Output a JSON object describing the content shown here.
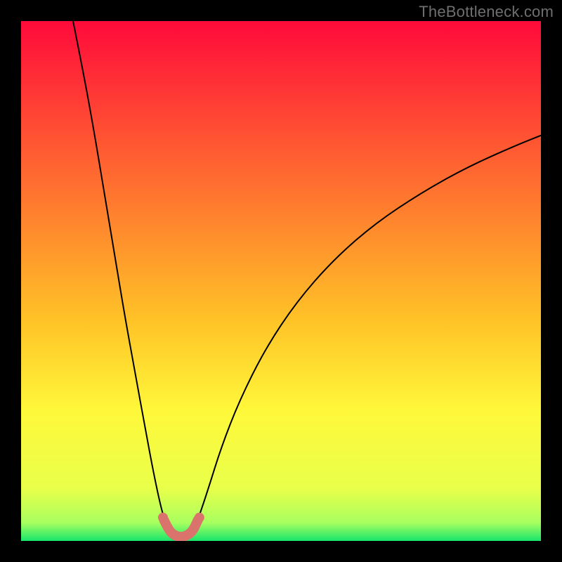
{
  "watermark": "TheBottleneck.com",
  "chart_data": {
    "type": "line",
    "title": "",
    "xlabel": "",
    "ylabel": "",
    "xlim": [
      0,
      100
    ],
    "ylim": [
      0,
      100
    ],
    "grid": false,
    "legend": false,
    "gradient_stops": [
      {
        "offset": 0.0,
        "color": "#ff0a3a"
      },
      {
        "offset": 0.18,
        "color": "#ff4534"
      },
      {
        "offset": 0.4,
        "color": "#ff8a2d"
      },
      {
        "offset": 0.58,
        "color": "#ffc427"
      },
      {
        "offset": 0.75,
        "color": "#fff83a"
      },
      {
        "offset": 0.9,
        "color": "#e8ff4a"
      },
      {
        "offset": 0.965,
        "color": "#a8ff5f"
      },
      {
        "offset": 1.0,
        "color": "#17e66b"
      }
    ],
    "series": [
      {
        "name": "curve-left",
        "stroke": "#000000",
        "x": [
          10.0,
          12.0,
          14.0,
          16.0,
          18.0,
          20.0,
          22.0,
          24.0,
          25.5,
          27.0,
          28.0,
          29.0
        ],
        "y": [
          100.0,
          90.0,
          79.0,
          67.0,
          55.0,
          43.0,
          32.0,
          21.0,
          13.0,
          6.0,
          3.0,
          1.5
        ]
      },
      {
        "name": "curve-right",
        "stroke": "#000000",
        "x": [
          33.0,
          34.0,
          36.0,
          38.5,
          42.0,
          47.0,
          53.0,
          60.0,
          68.0,
          77.0,
          86.0,
          95.0,
          100.0
        ],
        "y": [
          1.5,
          4.0,
          10.0,
          18.0,
          27.0,
          37.0,
          46.0,
          54.0,
          61.0,
          67.0,
          72.0,
          76.0,
          78.0
        ]
      },
      {
        "name": "valley-marker",
        "stroke": "#d9736b",
        "stroke_width": 14,
        "x": [
          27.5,
          28.5,
          30.0,
          31.5,
          33.0,
          34.0
        ],
        "y": [
          4.0,
          1.8,
          0.8,
          0.8,
          1.8,
          4.0
        ]
      }
    ],
    "markers": [
      {
        "x": 27.3,
        "y": 4.5,
        "r": 7,
        "fill": "#d9736b"
      },
      {
        "x": 34.3,
        "y": 4.5,
        "r": 7,
        "fill": "#d9736b"
      }
    ]
  }
}
